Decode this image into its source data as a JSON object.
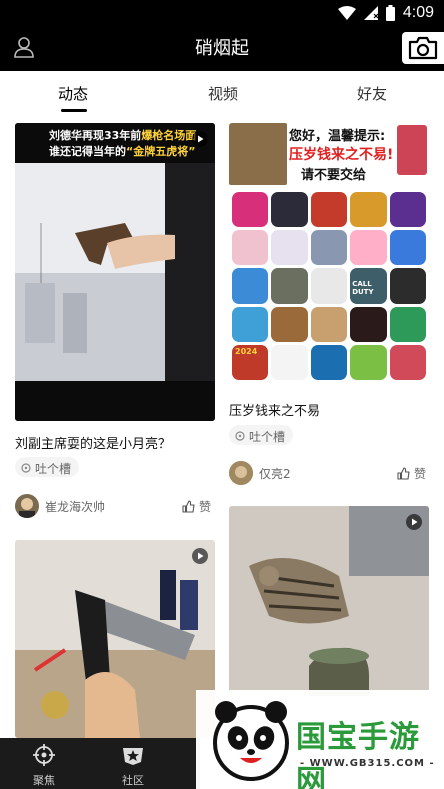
{
  "status": {
    "time": "4:09"
  },
  "app": {
    "title": "硝烟起"
  },
  "tabs": [
    {
      "label": "动态",
      "active": true
    },
    {
      "label": "视频",
      "active": false
    },
    {
      "label": "好友",
      "active": false
    }
  ],
  "feed": {
    "left": [
      {
        "overlay_top": "刘德华再现33年前",
        "overlay_highlight": "爆枪名场面",
        "overlay_line2": "谁还记得当年的",
        "overlay_quote": "“金牌五虎将”",
        "caption": "刘副主席耍的这是小月亮？",
        "tag": "吐个槽",
        "author": "崔龙海次帅",
        "like": "赞"
      },
      {
        "caption": ""
      }
    ],
    "right": [
      {
        "banner_line1": "您好，温馨提示:",
        "banner_line2": "压岁钱来之不易!",
        "banner_line3": "请不要交给",
        "caption": "压岁钱来之不易",
        "tag": "吐个槽",
        "author": "仅亮2",
        "like": "赞",
        "app_labels": [
          "CALL DUTY",
          "2024"
        ]
      },
      {
        "caption": ""
      }
    ]
  },
  "bottomnav": [
    {
      "label": "聚焦",
      "icon": "crosshair-icon"
    },
    {
      "label": "社区",
      "icon": "star-badge-icon"
    }
  ],
  "watermark": {
    "brand": "国宝手游网",
    "url": "- WWW.GB315.COM -"
  },
  "colors": {
    "bar": "#000000",
    "accent_red": "#e02020",
    "highlight_yellow": "#ffd23a"
  }
}
